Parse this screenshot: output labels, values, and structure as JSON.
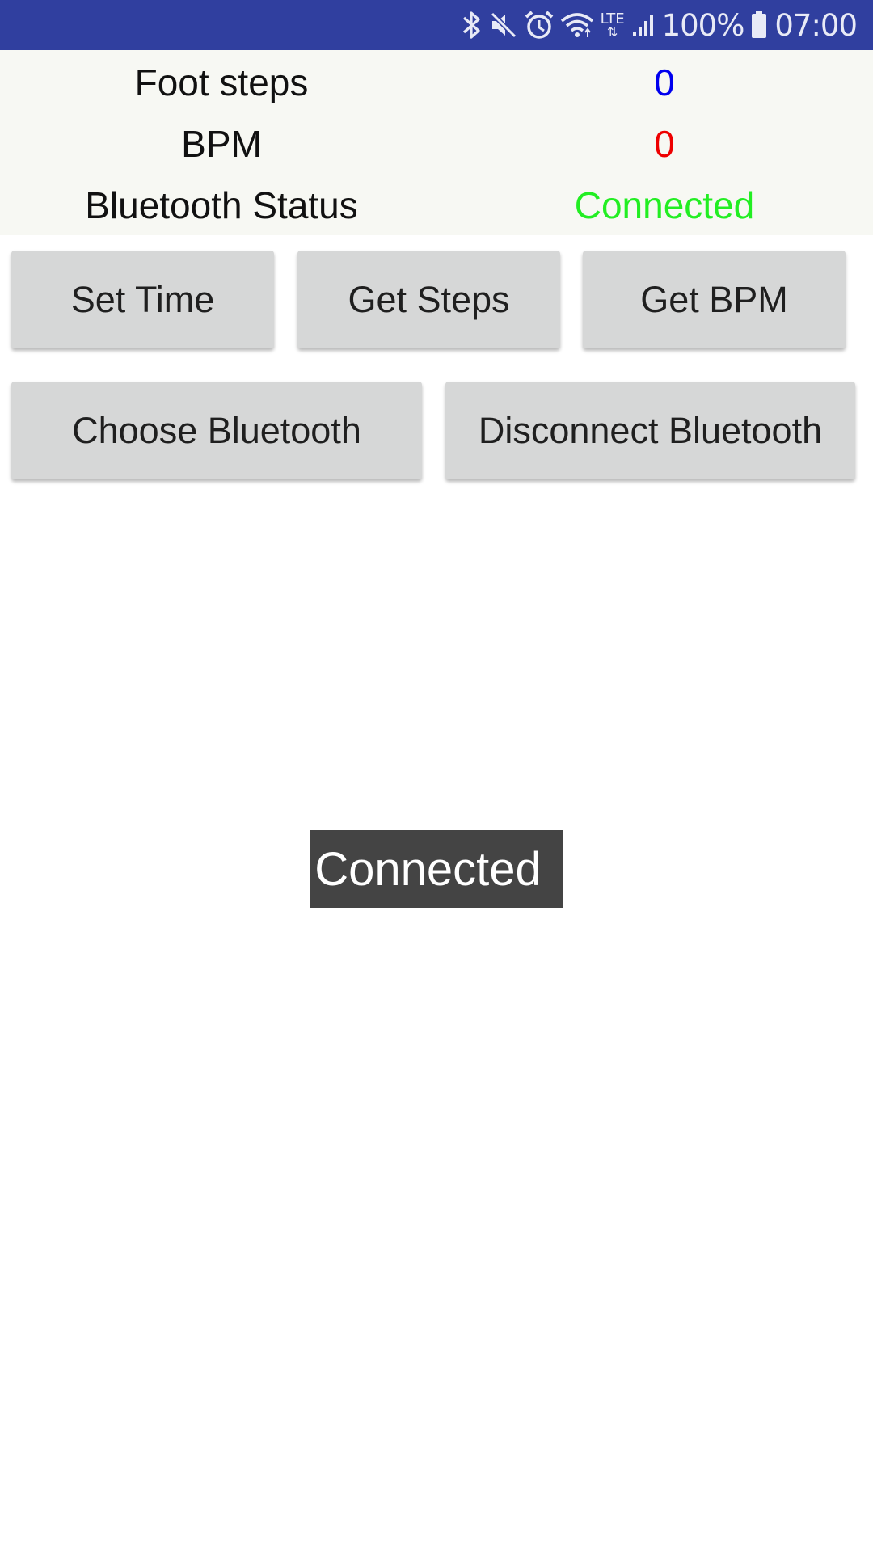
{
  "status_bar": {
    "battery_percent": "100%",
    "time": "07:00",
    "network_label": "LTE",
    "background_color": "#303F9F",
    "icons": [
      "bluetooth-icon",
      "mute-icon",
      "alarm-icon",
      "wifi-icon",
      "signal-icon",
      "battery-icon"
    ]
  },
  "info": {
    "rows": [
      {
        "label": "Foot steps",
        "value": "0",
        "value_color": "#0000EE"
      },
      {
        "label": "BPM",
        "value": "0",
        "value_color": "#EE0000"
      },
      {
        "label": "Bluetooth Status",
        "value": "Connected",
        "value_color": "#22EE22"
      }
    ]
  },
  "buttons": {
    "set_time": "Set Time",
    "get_steps": "Get Steps",
    "get_bpm": "Get BPM",
    "choose_bluetooth": "Choose Bluetooth",
    "disconnect_bluetooth": "Disconnect Bluetooth"
  },
  "toast": {
    "message": "Connected"
  }
}
